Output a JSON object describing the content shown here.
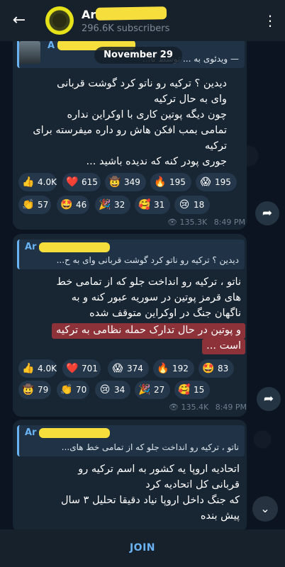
{
  "header": {
    "back_icon": "arrow-left-icon",
    "channel_name": "Ar",
    "subscribers": "296.6K subscribers",
    "menu_icon": "more-vertical-icon"
  },
  "date_pill": "November 29",
  "messages": [
    {
      "reply_name": "A",
      "reply_text": "— ویدئوی به ... توسط نا...",
      "lines": [
        "دیدین ؟ ترکیه رو ناتو کرد گوشت قربانی",
        "وای به حال ترکیه",
        "چون دیگه پوتین کاری با اوکراین نداره",
        "تمامی بمب افکن هاش رو داره میفرسته برای",
        "ترکیه",
        "جوری پودر کنه که ندیده باشید ..."
      ],
      "reactions": [
        {
          "emoji": "👍",
          "count": "4.0K"
        },
        {
          "emoji": "❤️",
          "count": "615"
        },
        {
          "emoji": "🤠",
          "count": "349"
        },
        {
          "emoji": "🔥",
          "count": "195"
        },
        {
          "emoji": "😱",
          "count": "195"
        },
        {
          "emoji": "👏",
          "count": "57"
        },
        {
          "emoji": "🤩",
          "count": "46"
        },
        {
          "emoji": "🎉",
          "count": "32"
        },
        {
          "emoji": "🥰",
          "count": "31"
        },
        {
          "emoji": "😢",
          "count": "18"
        }
      ],
      "views": "135.3K",
      "time": "8:49 PM"
    },
    {
      "reply_name": "Ar",
      "reply_text": "دیدین ؟ ترکیه رو ناتو کرد گوشت قربانی  وای به ح...",
      "lines": [
        "ناتو ، ترکیه رو انداخت جلو که از تمامی خط",
        "های قرمز پوتین در سوریه عبور کنه و به",
        "ناگهان جنگ در اوکراین متوقف شده",
        "و پوتین در حال تدارک حمله نظامی به ترکیه",
        "است ..."
      ],
      "reactions": [
        {
          "emoji": "👍",
          "count": "4.0K"
        },
        {
          "emoji": "❤️",
          "count": "701"
        },
        {
          "emoji": "😱",
          "count": "374"
        },
        {
          "emoji": "🔥",
          "count": "192"
        },
        {
          "emoji": "🤩",
          "count": "83"
        },
        {
          "emoji": "🤠",
          "count": "79"
        },
        {
          "emoji": "👏",
          "count": "70"
        },
        {
          "emoji": "😢",
          "count": "34"
        },
        {
          "emoji": "🎉",
          "count": "27"
        },
        {
          "emoji": "🥰",
          "count": "15"
        }
      ],
      "views": "135.4K",
      "time": "8:49 PM"
    },
    {
      "reply_name": "Ar",
      "reply_text": "ناتو ، ترکیه رو انداخت جلو که از تمامی خط های...",
      "lines": [
        "اتحادیه اروپا یه کشور به اسم ترکیه رو",
        "قربانی کل اتحادیه کرد",
        "که جنگ داخل اروپا نیاد دقیقا تحلیل ۳ سال",
        "پیش بنده"
      ]
    }
  ],
  "share_icon": "share-arrow-icon",
  "scroll_down_icon": "chevron-down-icon",
  "view_icon": "eye-icon",
  "join_label": "JOIN",
  "colors": {
    "accent": "#6ab3f3",
    "bubble": "#182533",
    "background": "#0e1621",
    "redact": "#f6df3d",
    "highlight": "#dc3c3c"
  }
}
